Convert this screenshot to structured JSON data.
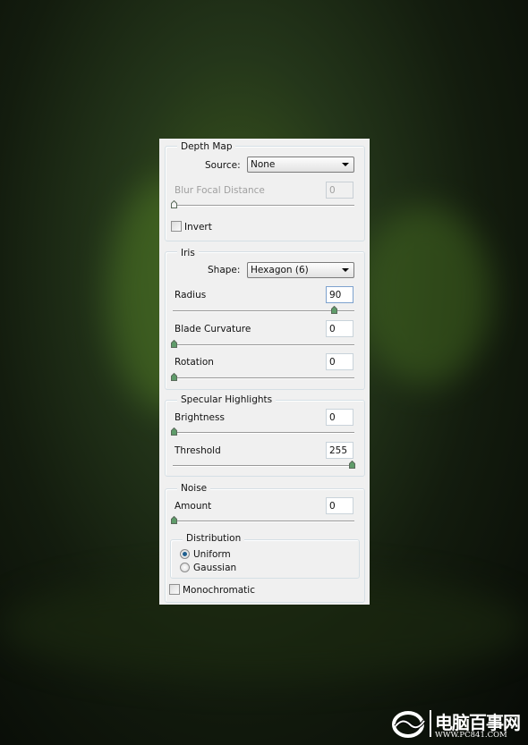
{
  "colors": {
    "panel": "#f0f0f0",
    "thumb": "#5f9c6a",
    "focus_border": "#7da2ce"
  },
  "depth_map": {
    "title": "Depth Map",
    "source_label": "Source:",
    "source_value": "None",
    "blur_focal_distance": {
      "label": "Blur Focal Distance",
      "value": "0",
      "slider_percent": 0,
      "disabled": true
    },
    "invert": {
      "label": "Invert",
      "checked": false
    }
  },
  "iris": {
    "title": "Iris",
    "shape_label": "Shape:",
    "shape_value": "Hexagon (6)",
    "radius": {
      "label": "Radius",
      "value": "90",
      "slider_percent": 90
    },
    "blade_curvature": {
      "label": "Blade Curvature",
      "value": "0",
      "slider_percent": 0
    },
    "rotation": {
      "label": "Rotation",
      "value": "0",
      "slider_percent": 0
    }
  },
  "specular": {
    "title": "Specular Highlights",
    "brightness": {
      "label": "Brightness",
      "value": "0",
      "slider_percent": 0
    },
    "threshold": {
      "label": "Threshold",
      "value": "255",
      "slider_percent": 100
    }
  },
  "noise": {
    "title": "Noise",
    "amount": {
      "label": "Amount",
      "value": "0",
      "slider_percent": 0
    },
    "distribution": {
      "title": "Distribution",
      "options": [
        {
          "label": "Uniform",
          "selected": true
        },
        {
          "label": "Gaussian",
          "selected": false
        }
      ]
    },
    "monochromatic": {
      "label": "Monochromatic",
      "checked": false
    }
  },
  "watermark": {
    "text_cn": "电脑百事网",
    "url": "WWW.PC841.COM"
  }
}
